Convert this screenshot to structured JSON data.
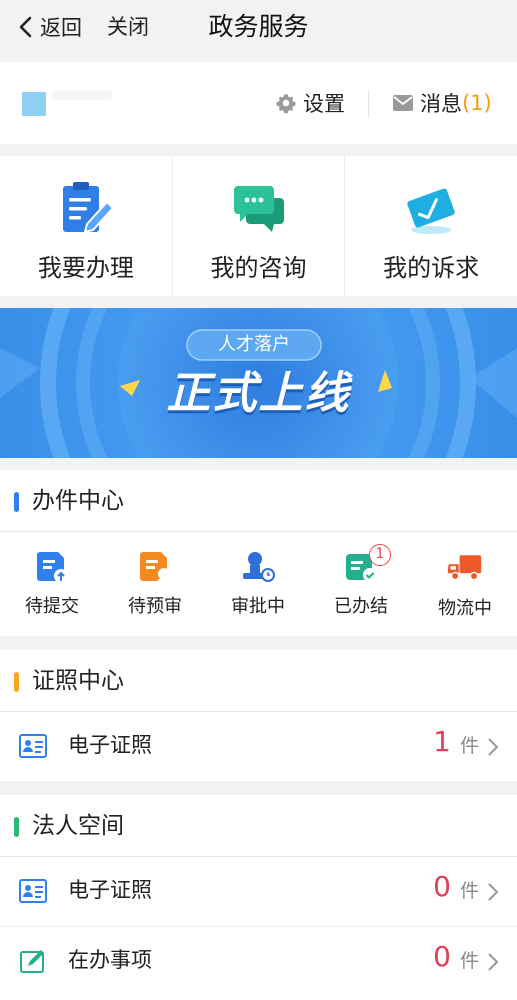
{
  "nav": {
    "back_label": "返回",
    "close_label": "关闭",
    "title": "政务服务"
  },
  "userbar": {
    "settings_label": "设置",
    "messages_label": "消息",
    "messages_count": "(1)"
  },
  "quick_actions": [
    {
      "label": "我要办理",
      "icon": "clipboard-edit-icon"
    },
    {
      "label": "我的咨询",
      "icon": "chat-bubbles-icon"
    },
    {
      "label": "我的诉求",
      "icon": "envelope-check-icon"
    }
  ],
  "banner": {
    "tag": "人才落户",
    "headline": "正式上线"
  },
  "handling_center": {
    "title": "办件中心",
    "items": [
      {
        "label": "待提交",
        "icon": "submit-doc-icon",
        "color": "#2f80ed"
      },
      {
        "label": "待预审",
        "icon": "review-doc-icon",
        "color": "#f28a1e"
      },
      {
        "label": "审批中",
        "icon": "approval-stamp-icon",
        "color": "#2f6fd8"
      },
      {
        "label": "已办结",
        "icon": "done-doc-icon",
        "color": "#23b08c",
        "badge": "1"
      },
      {
        "label": "物流中",
        "icon": "truck-icon",
        "color": "#ef5a2a"
      }
    ]
  },
  "license_center": {
    "title": "证照中心",
    "rows": [
      {
        "label": "电子证照",
        "count": "1",
        "unit": "件",
        "icon": "id-card-icon"
      }
    ]
  },
  "legal_space": {
    "title": "法人空间",
    "rows": [
      {
        "label": "电子证照",
        "count": "0",
        "unit": "件",
        "icon": "id-card-icon"
      },
      {
        "label": "在办事项",
        "count": "0",
        "unit": "件",
        "icon": "edit-note-icon"
      }
    ]
  },
  "colors": {
    "blue_bar": "#2f80ed",
    "orange_bar": "#f5a623",
    "green_bar": "#2bb673",
    "count_red": "#e0405c",
    "msg_orange": "#f39c12"
  }
}
